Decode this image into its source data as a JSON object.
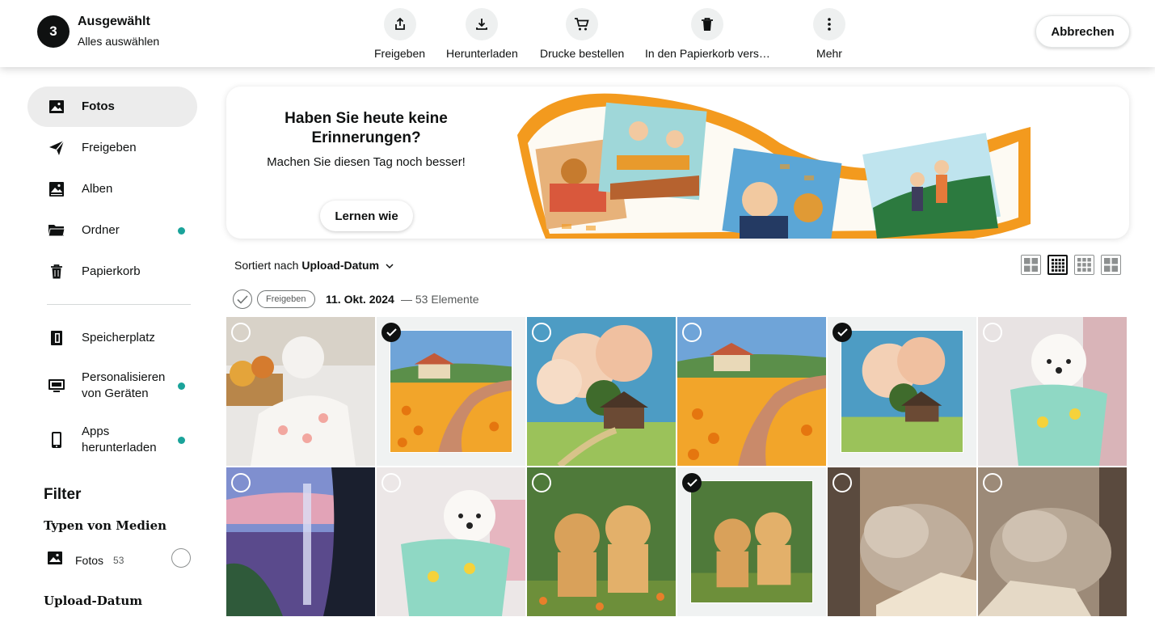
{
  "selection": {
    "count": "3",
    "title": "Ausgewählt",
    "select_all": "Alles auswählen",
    "actions": [
      {
        "label": "Freigeben",
        "icon": "share-icon"
      },
      {
        "label": "Herunterladen",
        "icon": "download-icon"
      },
      {
        "label": "Drucke bestellen",
        "icon": "cart-icon"
      },
      {
        "label": "In den Papierkorb vers…",
        "icon": "trash-icon"
      },
      {
        "label": "Mehr",
        "icon": "more-icon"
      }
    ],
    "cancel": "Abbrechen"
  },
  "sidebar": {
    "items": [
      {
        "label": "Fotos",
        "icon": "photo-icon",
        "active": true
      },
      {
        "label": "Freigeben",
        "icon": "send-icon"
      },
      {
        "label": "Alben",
        "icon": "album-icon"
      },
      {
        "label": "Ordner",
        "icon": "folder-icon",
        "dot": true
      },
      {
        "label": "Papierkorb",
        "icon": "trash-icon"
      }
    ],
    "items2": [
      {
        "label": "Speicherplatz",
        "icon": "storage-icon"
      },
      {
        "label": "Personalisieren von Geräten",
        "icon": "device-icon",
        "dot": true
      },
      {
        "label": "Apps herunterladen",
        "icon": "phone-icon",
        "dot": true
      }
    ]
  },
  "filter": {
    "heading": "Filter",
    "media_types": "Typen von Medien",
    "photos_label": "Fotos",
    "photos_count": "53",
    "upload_date": "Upload-Datum"
  },
  "banner": {
    "title": "Haben Sie heute keine Erinnerungen?",
    "subtitle": "Machen Sie diesen Tag noch besser!",
    "button": "Lernen wie"
  },
  "sort": {
    "prefix": "Sortiert nach",
    "value": "Upload-Datum"
  },
  "date_group": {
    "share_label": "Freigeben",
    "date": "11. Okt. 2024",
    "count": "— 53 Elemente"
  },
  "photos": [
    {
      "subject": "white dog in pink dress with flowers",
      "selected": false
    },
    {
      "subject": "painted sunflower field and house",
      "selected": true
    },
    {
      "subject": "painted clouds and cottage",
      "selected": false
    },
    {
      "subject": "painted sunflower field and house",
      "selected": false
    },
    {
      "subject": "painted clouds and cottage",
      "selected": true
    },
    {
      "subject": "white puppy in green dinosaur pajamas",
      "selected": false
    },
    {
      "subject": "waterfall at dusk from cave",
      "selected": false
    },
    {
      "subject": "white puppy in green dinosaur pajamas",
      "selected": false
    },
    {
      "subject": "two golden retriever puppies",
      "selected": false
    },
    {
      "subject": "two golden retriever puppies",
      "selected": true
    },
    {
      "subject": "tabby cat sleeping",
      "selected": false
    },
    {
      "subject": "tabby cat sleeping",
      "selected": false
    }
  ],
  "colors": {
    "accent_dot": "#1aa39a",
    "active_nav_bg": "#ececec",
    "banner_orange": "#f39a1e"
  }
}
